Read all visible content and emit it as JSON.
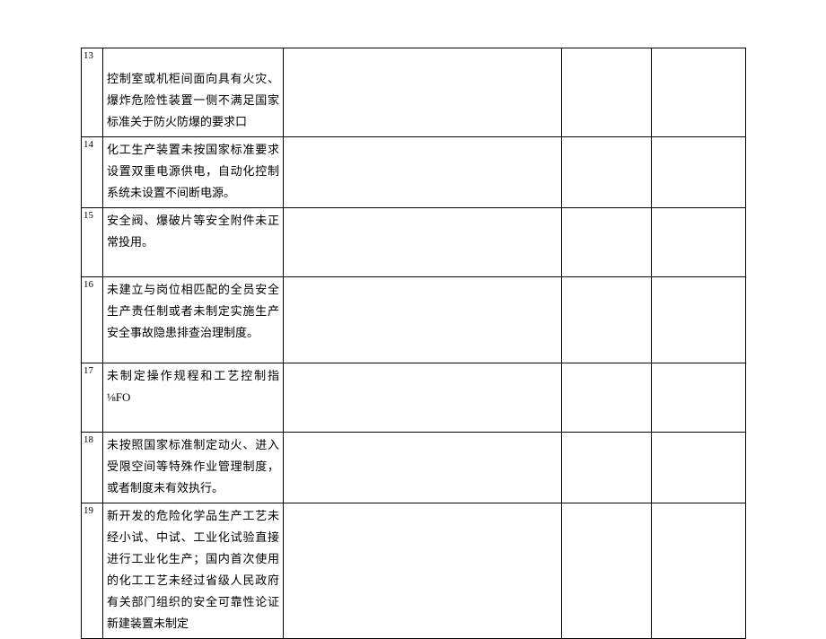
{
  "rows": [
    {
      "num": "13",
      "desc": "控制室或机柜间面向具有火灾、爆炸危险性装置一侧不满足国家标准关于防火防爆的要求口"
    },
    {
      "num": "14",
      "desc": "化工生产装置未按国家标准要求设置双重电源供电，自动化控制系统未设置不间断电源。"
    },
    {
      "num": "15",
      "desc": "安全阀、爆破片等安全附件未正常投用。"
    },
    {
      "num": "16",
      "desc": "未建立与岗位相匹配的全员安全生产责任制或者未制定实施生产安全事故隐患排查治理制度。"
    },
    {
      "num": "17",
      "desc": "未制定操作规程和工艺控制指⅛FO"
    },
    {
      "num": "18",
      "desc": "未按照国家标准制定动火、进入受限空间等特殊作业管理制度，或者制度未有效执行。"
    },
    {
      "num": "19",
      "desc": "新开发的危险化学品生产工艺未经小试、中试、工业化试验直接进行工业化生产；国内首次使用的化工工艺未经过省级人民政府有关部门组织的安全可靠性论证新建装置未制定"
    }
  ]
}
